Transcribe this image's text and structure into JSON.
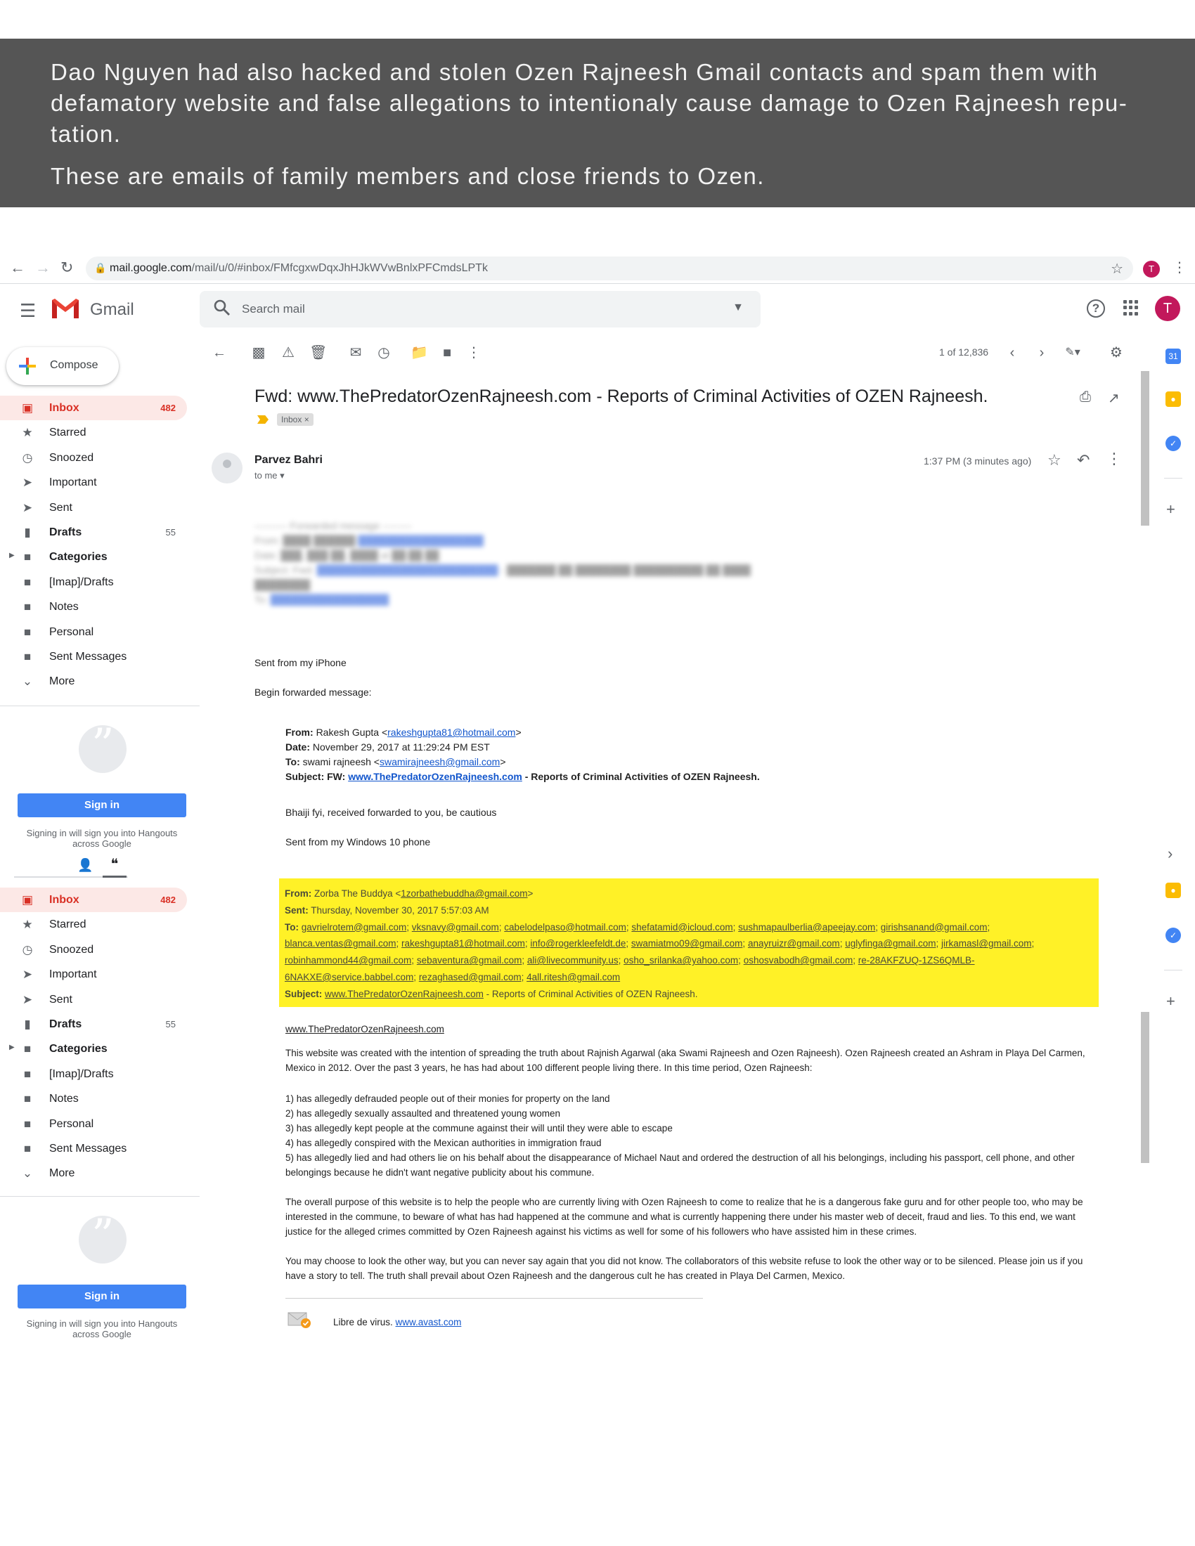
{
  "banner": {
    "paragraph1": "Dao Nguyen had also hacked and stolen Ozen Rajneesh Gmail contacts and spam them with defamatory website and false allegations to intentionaly cause damage to Ozen Rajneesh repu-tation.",
    "paragraph2": "These are emails of family members and close friends to Ozen."
  },
  "browser": {
    "url_host": "mail.google.com",
    "url_path": "/mail/u/0/#inbox/FMfcgxwDqxJhHJkWVwBnlxPFCmdsLPTk",
    "profile_initial": "T"
  },
  "header": {
    "app_name": "Gmail",
    "search_placeholder": "Search mail",
    "avatar_initial": "T"
  },
  "sidebar": {
    "compose_label": "Compose",
    "items": [
      {
        "label": "Inbox",
        "count": "482"
      },
      {
        "label": "Starred",
        "count": ""
      },
      {
        "label": "Snoozed",
        "count": ""
      },
      {
        "label": "Important",
        "count": ""
      },
      {
        "label": "Sent",
        "count": ""
      },
      {
        "label": "Drafts",
        "count": "55"
      },
      {
        "label": "Categories",
        "count": ""
      },
      {
        "label": "[Imap]/Drafts",
        "count": ""
      },
      {
        "label": "Notes",
        "count": ""
      },
      {
        "label": "Personal",
        "count": ""
      },
      {
        "label": "Sent Messages",
        "count": ""
      },
      {
        "label": "More",
        "count": ""
      }
    ],
    "signin_label": "Sign in",
    "signin_note": "Signing in will sign you into Hangouts across Google"
  },
  "toolbar": {
    "pager": "1 of 12,836"
  },
  "message": {
    "subject": "Fwd: www.ThePredatorOzenRajneesh.com - Reports of Criminal Activities of OZEN Rajneesh.",
    "label_chip": "Inbox ×",
    "sender": "Parvez Bahri",
    "to": "to me",
    "time": "1:37 PM (3 minutes ago)",
    "sent_from_iphone": "Sent from my iPhone",
    "begin_forwarded": "Begin forwarded message:",
    "fwd1": {
      "from_label": "From:",
      "from_name": "Rakesh Gupta <",
      "from_email": "rakeshgupta81@hotmail.com",
      "from_close": ">",
      "date_label": "Date:",
      "date": "November 29, 2017 at 11:29:24 PM EST",
      "to_label": "To:",
      "to_name": "swami rajneesh <",
      "to_email": "swamirajneesh@gmail.com",
      "to_close": ">",
      "subject_label": "Subject: FW:",
      "subject_link": "www.ThePredatorOzenRajneesh.com",
      "subject_rest": "- Reports of Criminal Activities of OZEN Rajneesh."
    },
    "bhaiji": "Bhaiji fyi, received forwarded to you, be cautious",
    "sent_from_windows": "Sent from my Windows 10 phone",
    "fwd2": {
      "from_label": "From:",
      "from_name": "Zorba The Buddya <",
      "from_email": "1zorbathebuddha@gmail.com",
      "from_close": ">",
      "sent_label": "Sent:",
      "sent": "Thursday, November 30, 2017 5:57:03 AM",
      "to_label": "To:",
      "recipients": [
        "gavrielrotem@gmail.com",
        "vksnavy@gmail.com",
        "cabelodelpaso@hotmail.com",
        "shefatamid@icloud.com",
        "sushmapaulberlia@apeejay.com",
        "girishsanand@gmail.com",
        "blanca.ventas@gmail.com",
        "rakeshgupta81@hotmail.com",
        "info@rogerkleefeldt.de",
        "swamiatmo09@gmail.com",
        "anayruizr@gmail.com",
        "uglyfinga@gmail.com",
        "jirkamasl@gmail.com",
        "robinhammond44@gmail.com",
        "sebaventura@gmail.com",
        "ali@livecommunity.us",
        "osho_srilanka@yahoo.com",
        "oshosvabodh@gmail.com",
        "re-28AKFZUQ-1ZS6QMLB-6NAKXE@service.babbel.com",
        "rezaghased@gmail.com",
        "4all.ritesh@gmail.com"
      ],
      "subject_label": "Subject:",
      "subject_link": "www.ThePredatorOzenRajneesh.com",
      "subject_rest": "- Reports of Criminal Activities of OZEN Rajneesh."
    },
    "site_link": "www.ThePredatorOzenRajneesh.com",
    "para1": " This website was created with the intention of spreading the truth about Rajnish Agarwal (aka Swami Rajneesh and Ozen Rajneesh). Ozen Rajneesh created an Ashram in Playa Del Carmen, Mexico in 2012. Over the past 3 years, he has had about 100 different people living there. In this time period, Ozen Rajneesh:",
    "list": [
      "1) has allegedly defrauded people out of their monies for property on the land",
      "2) has allegedly sexually assaulted and threatened young women",
      "3) has allegedly kept people at the commune against their will until they were able to escape",
      "4) has allegedly conspired with the Mexican authorities in immigration fraud",
      "5) has allegedly lied and had others lie on his behalf about the disappearance of Michael Naut and ordered the destruction of all his belongings, including his passport, cell phone, and other belongings because he didn't want negative publicity about his commune."
    ],
    "para2": "The overall purpose of this website is to help the people who are currently living with Ozen Rajneesh to come to realize that he is a dangerous fake guru and for other people too, who may be interested in the commune, to beware of what has had happened at the commune and what is currently happening there under his master web of deceit, fraud and lies. To this end, we want justice for the alleged crimes committed by Ozen Rajneesh against his victims as well for some of his followers who have assisted him in these crimes.",
    "para3": "You may choose to look the other way, but you can never say again that you did not know. The collaborators of this website refuse to look the other way or to be silenced. Please join us if you have a story to tell. The truth shall prevail about Ozen Rajneesh and the dangerous cult he has created in Playa Del Carmen, Mexico.",
    "avast_text": "Libre de virus. ",
    "avast_link": "www.avast.com"
  },
  "colors": {
    "banner_bg": "#555555",
    "gmail_red": "#d93025",
    "highlight": "#fff127",
    "signin_blue": "#4285f4",
    "link": "#1155cc"
  }
}
